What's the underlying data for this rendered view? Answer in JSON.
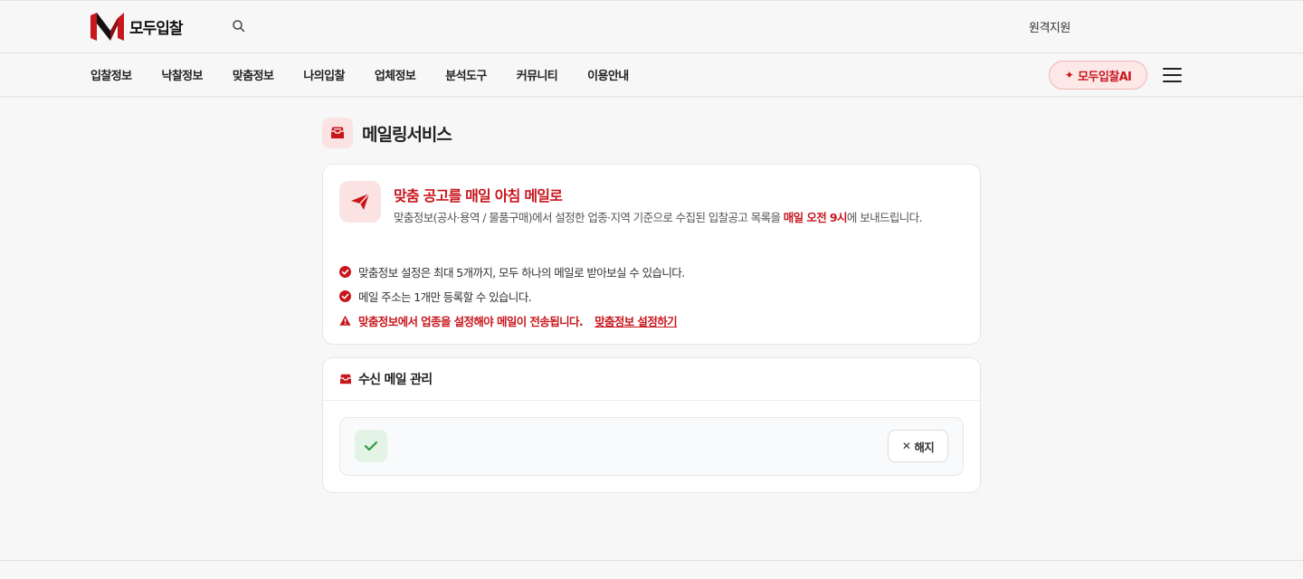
{
  "header": {
    "logo_text": "모두입찰",
    "remote_support": "원격지원"
  },
  "nav": {
    "items": [
      {
        "label": "입찰정보"
      },
      {
        "label": "낙찰정보"
      },
      {
        "label": "맞춤정보"
      },
      {
        "label": "나의입찰"
      },
      {
        "label": "업체정보"
      },
      {
        "label": "분석도구"
      },
      {
        "label": "커뮤니티"
      },
      {
        "label": "이용안내"
      }
    ],
    "ai_button": "모두입찰AI"
  },
  "page": {
    "title": "메일링서비스"
  },
  "intro": {
    "title": "맞춤 공고를 매일 아침 메일로",
    "desc_before": "맞춤정보(공사·용역 / 물품구매)에서 설정한 업종·지역 기준으로 수집된 입찰공고 목록을 ",
    "desc_highlight": "매일 오전 9시",
    "desc_after": "에 보내드립니다.",
    "checks": [
      {
        "text": "맞춤정보 설정은 최대 5개까지, 모두 하나의 메일로 받아보실 수 있습니다."
      },
      {
        "text": "메일 주소는 1개만 등록할 수 있습니다."
      }
    ],
    "warning": "맞춤정보에서 업종을 설정해야 메일이 전송됩니다.",
    "warning_link": "맞춤정보 설정하기"
  },
  "recipients": {
    "title": "수신 메일 관리",
    "email": "",
    "cancel_label": "해지"
  },
  "colors": {
    "brand_red": "#c8161d",
    "success_green": "#2e9a47"
  }
}
